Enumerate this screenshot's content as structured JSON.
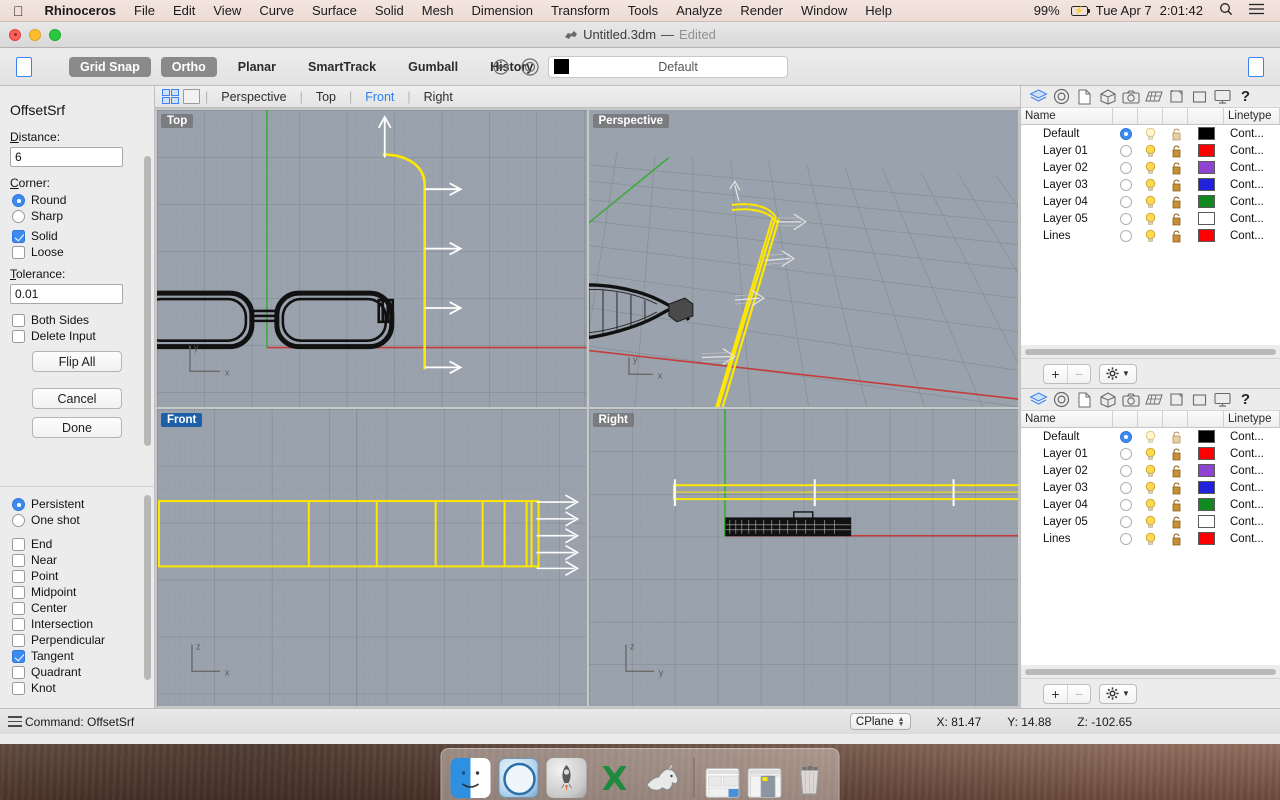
{
  "menubar": {
    "apple_icon": "apple-logo",
    "items": [
      "Rhinoceros",
      "File",
      "Edit",
      "View",
      "Curve",
      "Surface",
      "Solid",
      "Mesh",
      "Dimension",
      "Transform",
      "Tools",
      "Analyze",
      "Render",
      "Window",
      "Help"
    ],
    "battery": "99%",
    "day": "Tue Apr 7",
    "time": "2:01:42",
    "search_icon": "magnifier-icon",
    "control_center_icon": "list-icon"
  },
  "window": {
    "title": "Untitled.3dm",
    "separator": "—",
    "edited": "Edited",
    "app_icon": "rhino-icon"
  },
  "toolbar": {
    "left_panel_toggle": "left-panel-icon",
    "buttons": [
      {
        "label": "Grid Snap",
        "active": true
      },
      {
        "label": "Ortho",
        "active": true
      },
      {
        "label": "Planar",
        "active": false
      },
      {
        "label": "SmartTrack",
        "active": false
      },
      {
        "label": "Gumball",
        "active": false
      },
      {
        "label": "History",
        "active": false
      }
    ],
    "layer_prev_icon": "layer-prev-icon",
    "layer_target_icon": "layer-target-icon",
    "layer_color": "#000000",
    "layer_name": "Default",
    "right_panel_toggle": "right-panel-icon"
  },
  "sidebar": {
    "command_title": "OffsetSrf",
    "distance_label": "Distance:",
    "distance_value": "6",
    "corner_label": "Corner:",
    "corner_options": [
      {
        "label": "Round",
        "selected": true
      },
      {
        "label": "Sharp",
        "selected": false
      }
    ],
    "solid_label": "Solid",
    "solid_checked": true,
    "loose_label": "Loose",
    "loose_checked": false,
    "tolerance_label": "Tolerance:",
    "tolerance_value": "0.01",
    "both_sides_label": "Both Sides",
    "both_sides_checked": false,
    "delete_input_label": "Delete Input",
    "delete_input_checked": false,
    "flip_all_label": "Flip All",
    "cancel_label": "Cancel",
    "done_label": "Done",
    "osnap_modes": [
      {
        "label": "Persistent",
        "selected": true
      },
      {
        "label": "One shot",
        "selected": false
      }
    ],
    "osnap_items": [
      {
        "label": "End",
        "checked": false
      },
      {
        "label": "Near",
        "checked": false
      },
      {
        "label": "Point",
        "checked": false
      },
      {
        "label": "Midpoint",
        "checked": false
      },
      {
        "label": "Center",
        "checked": false
      },
      {
        "label": "Intersection",
        "checked": false
      },
      {
        "label": "Perpendicular",
        "checked": false
      },
      {
        "label": "Tangent",
        "checked": true
      },
      {
        "label": "Quadrant",
        "checked": false
      },
      {
        "label": "Knot",
        "checked": false
      }
    ]
  },
  "viewtabs": {
    "four_view_icon": "four-viewport-icon",
    "single_view_icon": "single-viewport-icon",
    "tabs": [
      {
        "label": "Perspective",
        "active": false
      },
      {
        "label": "Top",
        "active": false
      },
      {
        "label": "Front",
        "active": true
      },
      {
        "label": "Right",
        "active": false
      }
    ]
  },
  "viewports": [
    {
      "name": "Top",
      "active": false,
      "axis_labels": [
        "x",
        "y"
      ]
    },
    {
      "name": "Perspective",
      "active": false,
      "axis_labels": [
        "x",
        "y"
      ]
    },
    {
      "name": "Front",
      "active": true,
      "axis_labels": [
        "x",
        "z"
      ]
    },
    {
      "name": "Right",
      "active": false,
      "axis_labels": [
        "y",
        "z"
      ]
    }
  ],
  "panels": {
    "tab_icons": [
      "layers-icon",
      "properties-icon",
      "notes-icon",
      "object-icon",
      "camera-icon",
      "ground-plane-icon",
      "named-views-icon",
      "named-cplanes-icon",
      "display-icon",
      "help-icon"
    ],
    "active_tab": "layers-icon",
    "columns": [
      "Name",
      "",
      "",
      "",
      "",
      "",
      "Linetype"
    ],
    "layers": [
      {
        "name": "Default",
        "current": true,
        "color": "#000000",
        "linetype": "Cont..."
      },
      {
        "name": "Layer 01",
        "current": false,
        "color": "#ff0000",
        "linetype": "Cont..."
      },
      {
        "name": "Layer 02",
        "current": false,
        "color": "#8e44d0",
        "linetype": "Cont..."
      },
      {
        "name": "Layer 03",
        "current": false,
        "color": "#2222dd",
        "linetype": "Cont..."
      },
      {
        "name": "Layer 04",
        "current": false,
        "color": "#118822",
        "linetype": "Cont..."
      },
      {
        "name": "Layer 05",
        "current": false,
        "color": "#ffffff",
        "linetype": "Cont..."
      },
      {
        "name": "Lines",
        "current": false,
        "color": "#ff0000",
        "linetype": "Cont..."
      }
    ],
    "add_label": "+",
    "remove_label": "−",
    "gear_icon": "gear-icon",
    "chevron_icon": "chevron-down-icon"
  },
  "statusbar": {
    "menu_icon": "hamburger-icon",
    "command_text": "Command: OffsetSrf",
    "cplane_label": "CPlane",
    "x": "X: 81.47",
    "y": "Y: 14.88",
    "z": "Z: -102.65"
  },
  "dock": {
    "items": [
      {
        "name": "finder-icon"
      },
      {
        "name": "safari-icon"
      },
      {
        "name": "launchpad-icon"
      },
      {
        "name": "excel-icon"
      },
      {
        "name": "rhinoceros-icon"
      }
    ],
    "minimized": [
      {
        "name": "minimized-window-1"
      },
      {
        "name": "minimized-window-2"
      }
    ],
    "trash": {
      "name": "trash-icon"
    }
  },
  "colors": {
    "accent": "#3b82f6",
    "selection_yellow": "#ffe800",
    "viewport_bg": "#9aa3ad",
    "axis_red": "#c43c3c",
    "axis_green": "#3caa3c"
  }
}
